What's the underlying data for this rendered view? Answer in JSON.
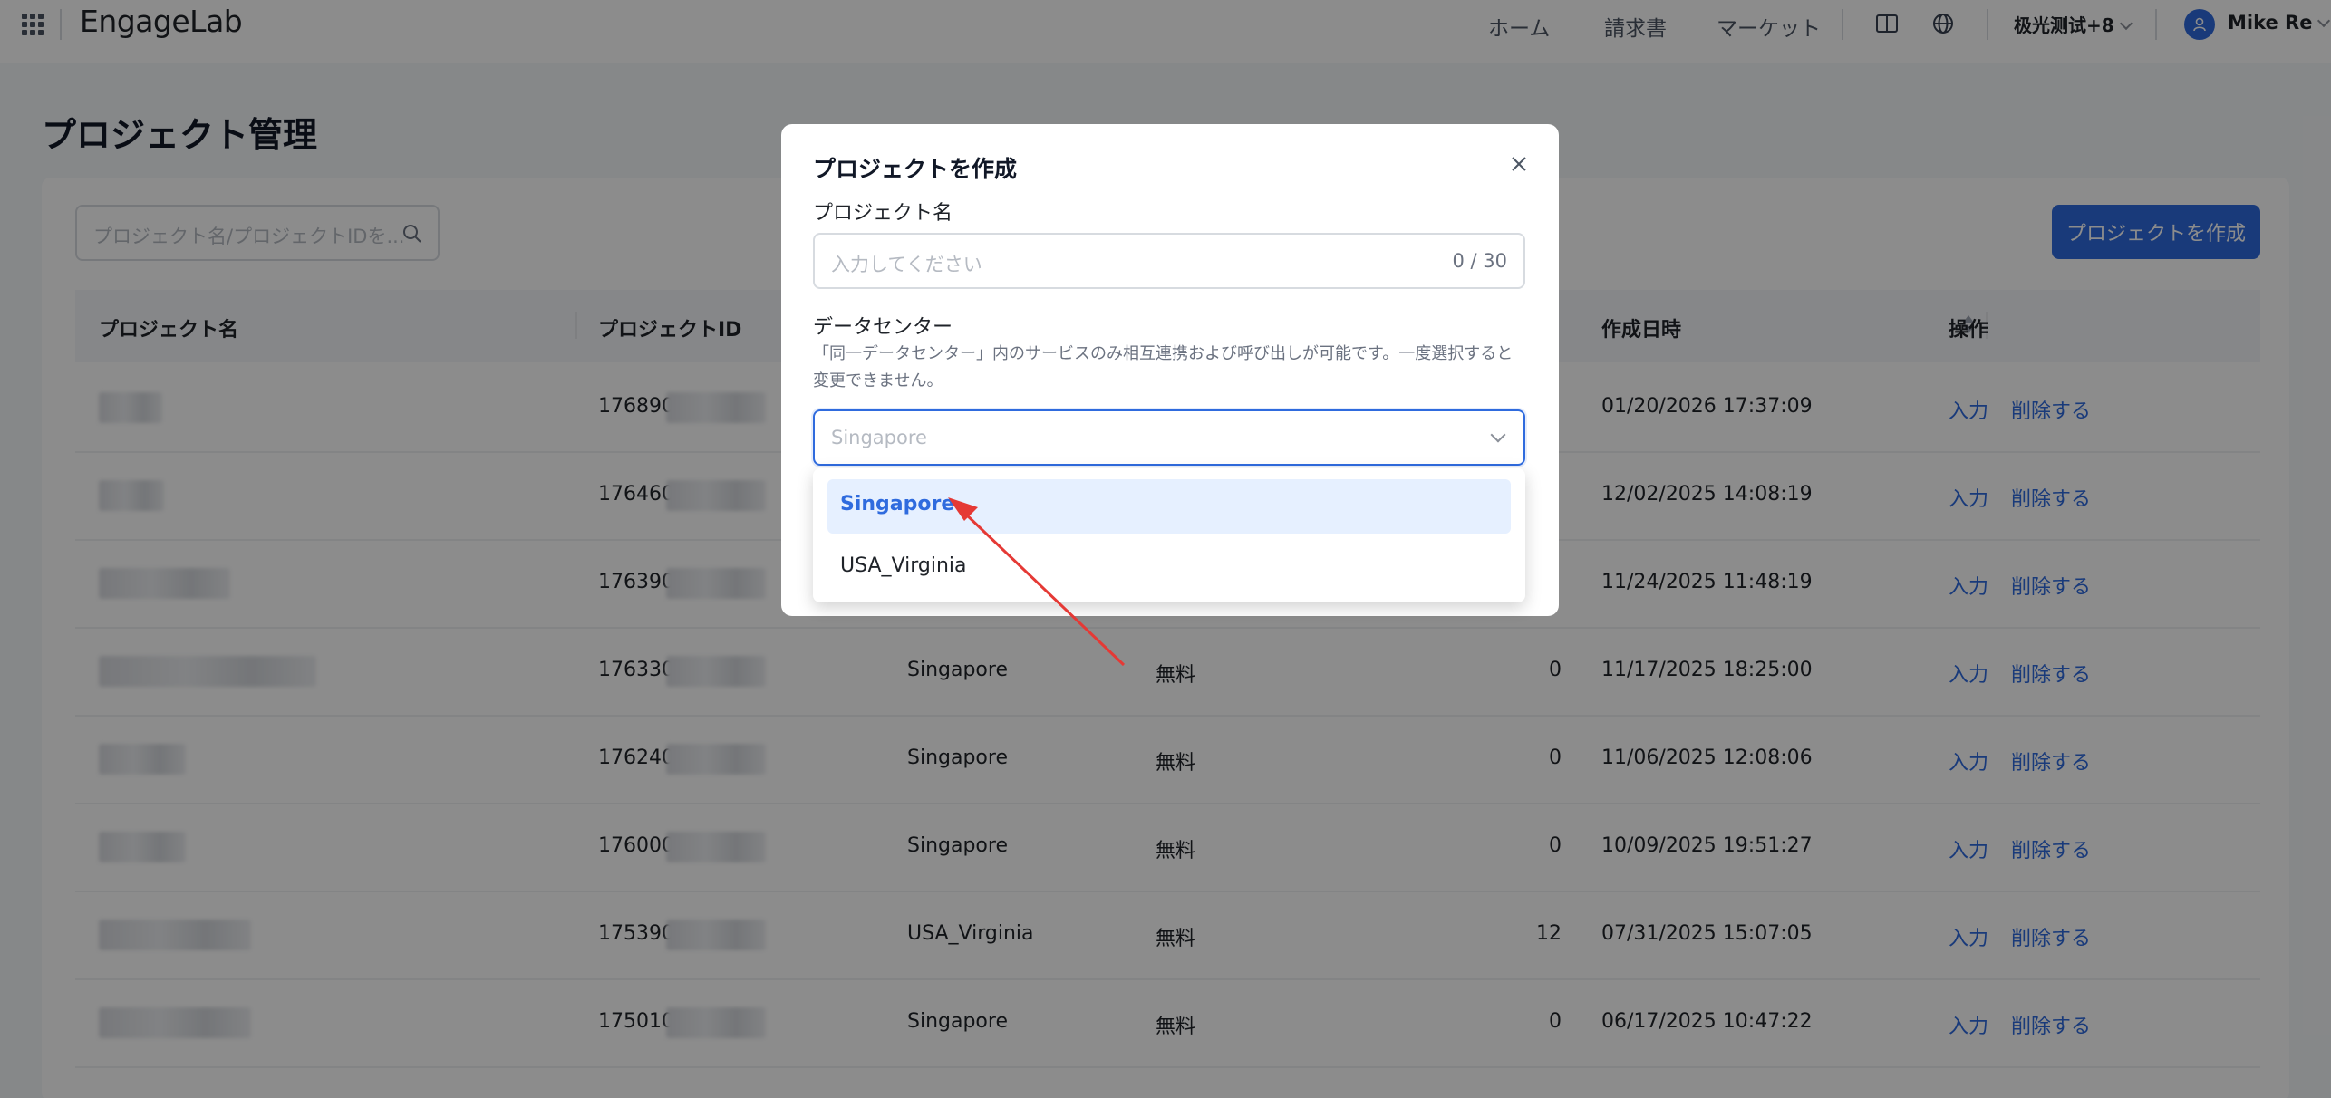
{
  "topbar": {
    "logo": "EngageLab",
    "nav": [
      "ホーム",
      "請求書",
      "マーケット"
    ],
    "org": "极光测试+8",
    "user": "Mike Re"
  },
  "page": {
    "title": "プロジェクト管理",
    "search_placeholder": "プロジェクト名/プロジェクトIDを...",
    "create_button": "プロジェクトを作成"
  },
  "table": {
    "headers": {
      "name": "プロジェクト名",
      "id": "プロジェクトID",
      "created": "作成日時",
      "actions": "操作"
    },
    "rows": [
      {
        "id": "176890",
        "region": "",
        "plan": "",
        "count": "",
        "created": "01/20/2026 17:37:09",
        "blurw": 70
      },
      {
        "id": "176460",
        "region": "",
        "plan": "",
        "count": "",
        "created": "12/02/2025 14:08:19",
        "blurw": 72
      },
      {
        "id": "176390",
        "region": "",
        "plan": "",
        "count": "",
        "created": "11/24/2025 11:48:19",
        "blurw": 145
      },
      {
        "id": "176330",
        "region": "Singapore",
        "plan": "無料",
        "count": "0",
        "created": "11/17/2025 18:25:00",
        "blurw": 240
      },
      {
        "id": "176240",
        "region": "Singapore",
        "plan": "無料",
        "count": "0",
        "created": "11/06/2025 12:08:06",
        "blurw": 96
      },
      {
        "id": "176000",
        "region": "Singapore",
        "plan": "無料",
        "count": "0",
        "created": "10/09/2025 19:51:27",
        "blurw": 96
      },
      {
        "id": "175390",
        "region": "USA_Virginia",
        "plan": "無料",
        "count": "12",
        "created": "07/31/2025 15:07:05",
        "blurw": 168
      },
      {
        "id": "175010",
        "region": "Singapore",
        "plan": "無料",
        "count": "0",
        "created": "06/17/2025 10:47:22",
        "blurw": 168
      }
    ],
    "action_enter": "入力",
    "action_delete": "削除する"
  },
  "modal": {
    "title": "プロジェクトを作成",
    "name_label": "プロジェクト名",
    "name_placeholder": "入力してください",
    "name_counter": "0 / 30",
    "dc_label": "データセンター",
    "dc_hint": "「同一データセンター」内のサービスのみ相互連携および呼び出しが可能です。一度選択すると変更できません。",
    "dc_placeholder": "Singapore",
    "options": [
      "Singapore",
      "USA_Virginia"
    ]
  },
  "colors": {
    "primary": "#2f6bde",
    "option_selected_bg": "#e6f0ff",
    "annotation_arrow": "#e53935"
  }
}
